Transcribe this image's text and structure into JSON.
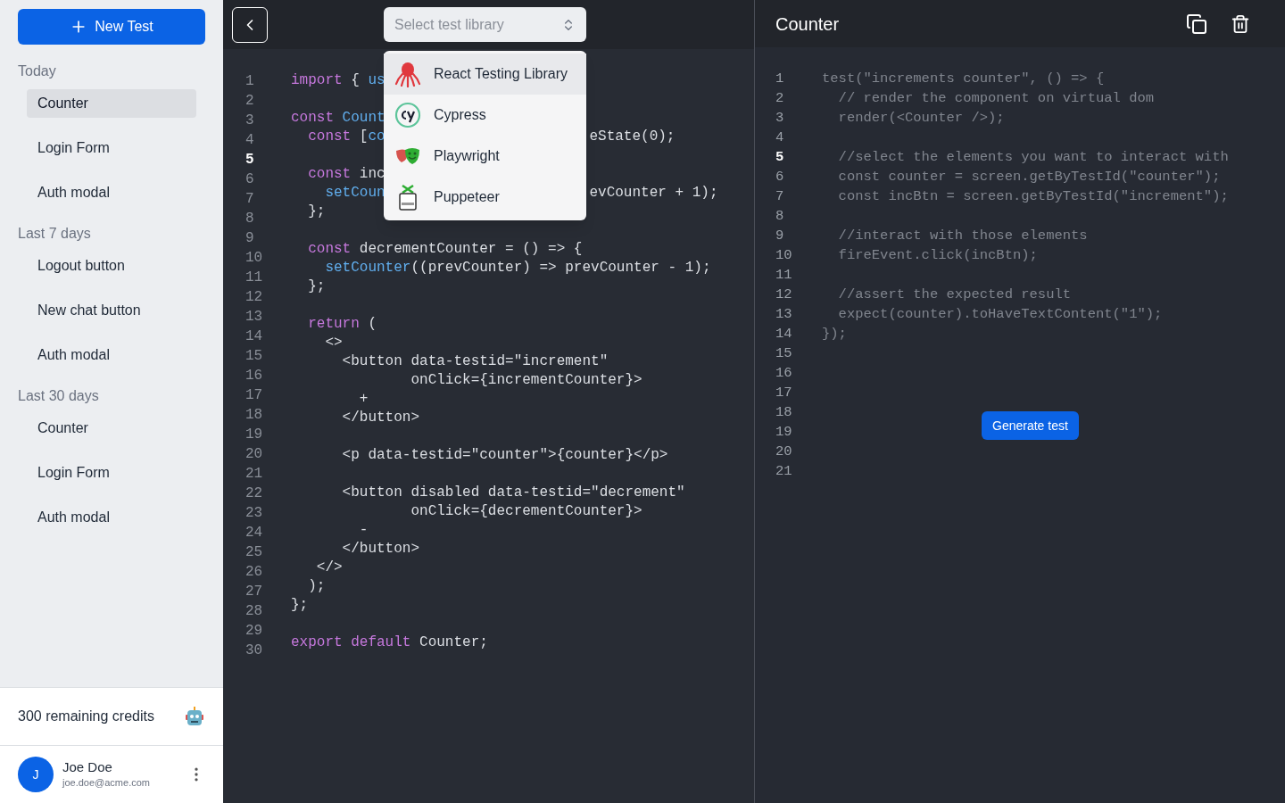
{
  "sidebar": {
    "new_button": "New Test",
    "sections": [
      {
        "title": "Today",
        "items": [
          {
            "label": "Counter",
            "selected": true
          },
          {
            "label": "Login Form",
            "selected": false
          },
          {
            "label": "Auth modal",
            "selected": false
          }
        ]
      },
      {
        "title": "Last 7 days",
        "items": [
          {
            "label": "Logout button",
            "selected": false
          },
          {
            "label": "New chat button",
            "selected": false
          },
          {
            "label": "Auth modal",
            "selected": false
          }
        ]
      },
      {
        "title": "Last 30 days",
        "items": [
          {
            "label": "Counter",
            "selected": false
          },
          {
            "label": "Login Form",
            "selected": false
          },
          {
            "label": "Auth modal",
            "selected": false
          }
        ]
      }
    ],
    "credits": "300 remaining credits",
    "user": {
      "initial": "J",
      "name": "Joe Doe",
      "email": "joe.doe@acme.com"
    }
  },
  "editor": {
    "select": {
      "placeholder": "Select test library"
    },
    "menu": [
      {
        "label": "React Testing Library",
        "kind": "octopus",
        "selected": true
      },
      {
        "label": "Cypress",
        "kind": "ring",
        "selected": false
      },
      {
        "label": "Playwright",
        "kind": "masks",
        "selected": false
      },
      {
        "label": "Puppeteer",
        "kind": "box",
        "selected": false
      }
    ],
    "gutter": [
      {
        "number": "1",
        "active": false
      },
      {
        "number": "2",
        "active": false
      },
      {
        "number": "3",
        "active": false
      },
      {
        "number": "4",
        "active": false
      },
      {
        "number": "5",
        "active": true
      },
      {
        "number": "6",
        "active": false
      },
      {
        "number": "7",
        "active": false
      },
      {
        "number": "8",
        "active": false
      },
      {
        "number": "9",
        "active": false
      },
      {
        "number": "10",
        "active": false
      },
      {
        "number": "11",
        "active": false
      },
      {
        "number": "12",
        "active": false
      },
      {
        "number": "13",
        "active": false
      },
      {
        "number": "14",
        "active": false
      },
      {
        "number": "15",
        "active": false
      },
      {
        "number": "16",
        "active": false
      },
      {
        "number": "17",
        "active": false
      },
      {
        "number": "18",
        "active": false
      },
      {
        "number": "19",
        "active": false
      },
      {
        "number": "20",
        "active": false
      },
      {
        "number": "21",
        "active": false
      },
      {
        "number": "22",
        "active": false
      },
      {
        "number": "23",
        "active": false
      },
      {
        "number": "24",
        "active": false
      },
      {
        "number": "25",
        "active": false
      },
      {
        "number": "26",
        "active": false
      },
      {
        "number": "27",
        "active": false
      },
      {
        "number": "28",
        "active": false
      },
      {
        "number": "29",
        "active": false
      },
      {
        "number": "30",
        "active": false
      }
    ],
    "blocks": [
      {
        "lines": [
          {
            "tokens": [
              {
                "kind": "keyword",
                "text": "import"
              },
              {
                "kind": "text",
                "text": " { "
              },
              {
                "kind": "function",
                "text": "us"
              }
            ]
          }
        ]
      },
      {
        "lines": [
          {
            "tokens": [
              {
                "kind": "keyword",
                "text": "const"
              },
              {
                "kind": "function",
                "text": " Count"
              }
            ]
          },
          {
            "tokens": [
              {
                "kind": "keyword",
                "text": "  const"
              },
              {
                "kind": "text",
                "text": " ["
              },
              {
                "kind": "function",
                "text": "co"
              }
            ],
            "right": [
              {
                "kind": "text",
                "text": "eState(0);"
              }
            ]
          }
        ]
      },
      {
        "lines": [
          {
            "tokens": [
              {
                "kind": "keyword",
                "text": "  const"
              },
              {
                "kind": "text",
                "text": " inc"
              }
            ]
          },
          {
            "tokens": [
              {
                "kind": "function",
                "text": "    setCoun"
              }
            ],
            "right": [
              {
                "kind": "text",
                "text": "evCounter + 1);"
              }
            ]
          },
          {
            "tokens": [
              {
                "kind": "text",
                "text": "  };"
              }
            ]
          }
        ]
      },
      {
        "lines": [
          {
            "tokens": [
              {
                "kind": "keyword",
                "text": "  const"
              },
              {
                "kind": "text",
                "text": " decrementCounter = () => {"
              }
            ]
          },
          {
            "tokens": [
              {
                "kind": "function",
                "text": "    setCounter"
              },
              {
                "kind": "text",
                "text": "((prevCounter) => prevCounter - 1);"
              }
            ]
          },
          {
            "tokens": [
              {
                "kind": "text",
                "text": "  };"
              }
            ]
          }
        ]
      },
      {
        "lines": [
          {
            "tokens": [
              {
                "kind": "keyword",
                "text": "  return"
              },
              {
                "kind": "text",
                "text": " ("
              }
            ]
          },
          {
            "tokens": [
              {
                "kind": "text",
                "text": "    <>"
              }
            ]
          },
          {
            "tokens": [
              {
                "kind": "text",
                "text": "      <button data-testid=\"increment\""
              }
            ]
          },
          {
            "tokens": [
              {
                "kind": "text",
                "text": "              onClick={incrementCounter}>"
              }
            ]
          },
          {
            "tokens": [
              {
                "kind": "text",
                "text": "        +"
              }
            ]
          },
          {
            "tokens": [
              {
                "kind": "text",
                "text": "      </button>"
              }
            ]
          }
        ]
      },
      {
        "lines": [
          {
            "tokens": [
              {
                "kind": "text",
                "text": "      <p data-testid=\"counter\">{counter}</p>"
              }
            ]
          }
        ]
      },
      {
        "lines": [
          {
            "tokens": [
              {
                "kind": "text",
                "text": "      <button disabled data-testid=\"decrement\""
              }
            ]
          },
          {
            "tokens": [
              {
                "kind": "text",
                "text": "              onClick={decrementCounter}>"
              }
            ]
          },
          {
            "tokens": [
              {
                "kind": "text",
                "text": "        -"
              }
            ]
          },
          {
            "tokens": [
              {
                "kind": "text",
                "text": "      </button>"
              }
            ]
          },
          {
            "tokens": [
              {
                "kind": "text",
                "text": "   </>"
              }
            ]
          },
          {
            "tokens": [
              {
                "kind": "text",
                "text": "  );"
              }
            ]
          },
          {
            "tokens": [
              {
                "kind": "text",
                "text": "};"
              }
            ]
          }
        ]
      },
      {
        "lines": [
          {
            "tokens": [
              {
                "kind": "keyword",
                "text": "export"
              },
              {
                "kind": "keyword",
                "text": " default"
              },
              {
                "kind": "text",
                "text": " Counter;"
              }
            ]
          }
        ]
      }
    ]
  },
  "output": {
    "title": "Counter",
    "gutter": [
      {
        "number": "1",
        "active": false
      },
      {
        "number": "2",
        "active": false
      },
      {
        "number": "3",
        "active": false
      },
      {
        "number": "4",
        "active": false
      },
      {
        "number": "5",
        "active": true
      },
      {
        "number": "6",
        "active": false
      },
      {
        "number": "7",
        "active": false
      },
      {
        "number": "8",
        "active": false
      },
      {
        "number": "9",
        "active": false
      },
      {
        "number": "10",
        "active": false
      },
      {
        "number": "11",
        "active": false
      },
      {
        "number": "12",
        "active": false
      },
      {
        "number": "13",
        "active": false
      },
      {
        "number": "14",
        "active": false
      },
      {
        "number": "15",
        "active": false
      },
      {
        "number": "16",
        "active": false
      },
      {
        "number": "17",
        "active": false
      },
      {
        "number": "18",
        "active": false
      },
      {
        "number": "19",
        "active": false
      },
      {
        "number": "20",
        "active": false
      },
      {
        "number": "21",
        "active": false
      }
    ],
    "blocks": [
      {
        "lines": [
          "test(\"increments counter\", () => {",
          "  // render the component on virtual dom",
          "  render(<Counter />);"
        ]
      },
      {
        "lines": [
          "  //select the elements you want to interact with",
          "  const counter = screen.getByTestId(\"counter\");",
          "  const incBtn = screen.getByTestId(\"increment\");"
        ]
      },
      {
        "lines": [
          "  //interact with those elements",
          "  fireEvent.click(incBtn);"
        ]
      },
      {
        "lines": [
          "  //assert the expected result",
          "  expect(counter).toHaveTextContent(\"1\");",
          "});"
        ]
      }
    ],
    "generate_button": "Generate test"
  }
}
